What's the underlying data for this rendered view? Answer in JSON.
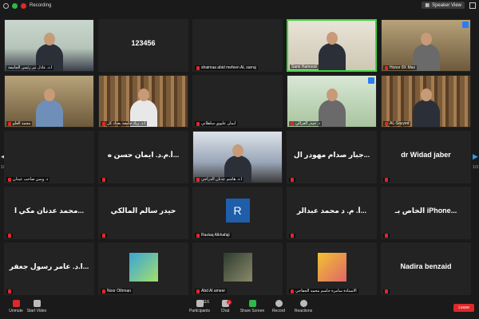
{
  "topbar": {
    "recording_label": "Recording",
    "speaker_view_label": "Speaker View"
  },
  "tiles": [
    {
      "name": "أ.د. عادل تبر رئيس الجامعة",
      "type": "video",
      "bg": "v-office",
      "person": "dark",
      "muted": false
    },
    {
      "name": "",
      "bigtext": "123456",
      "type": "text",
      "muted": false
    },
    {
      "name": "shaimaa abid mefeen AL sarraj",
      "type": "blank",
      "muted": true
    },
    {
      "name": "Sami Hamood",
      "type": "video",
      "bg": "v-light",
      "person": "dark",
      "muted": false,
      "active": true
    },
    {
      "name": "Honor 8X Max",
      "type": "video",
      "bg": "v-room",
      "person": "gray",
      "muted": true,
      "hand": true
    },
    {
      "name": "محمد العلو",
      "type": "video",
      "bg": "v-room",
      "person": "blue",
      "muted": true
    },
    {
      "name": "أ.د. زياد جامعة بغداد كل",
      "type": "video",
      "bg": "v-shelf",
      "person": "light",
      "muted": true
    },
    {
      "name": "ايمان عليوي سلطاني",
      "type": "blank",
      "muted": true
    },
    {
      "name": "د. حيدر الغزالي",
      "type": "video",
      "bg": "v-green",
      "person": "gray",
      "muted": true,
      "hand": true
    },
    {
      "name": "AL-Sayyed",
      "type": "video",
      "bg": "v-shelf",
      "person": "dark",
      "muted": true
    },
    {
      "name": "د. وسن صاحب عيدان",
      "bigtext": "",
      "type": "blank",
      "muted": true
    },
    {
      "name": "",
      "bigtext": "أ.م.د. ايمان حسن ه...",
      "type": "text",
      "muted": true
    },
    {
      "name": "ا.د. هاشم عدنان الدراجي",
      "type": "video",
      "bg": "v-podium",
      "person": "dark",
      "muted": true
    },
    {
      "name": "",
      "bigtext": "جبار صدام مهودر ال...",
      "type": "text",
      "muted": true
    },
    {
      "name": "",
      "bigtext": "dr Widad jaber",
      "type": "text",
      "muted": true
    },
    {
      "name": "",
      "bigtext": "محمد عدنان مكي ا...",
      "type": "text",
      "muted": true
    },
    {
      "name": "",
      "bigtext": "حيدر سالم المالكي",
      "type": "text",
      "muted": true
    },
    {
      "name": "Raziaq Alkhafaji",
      "type": "avatar",
      "letter": "R",
      "muted": true
    },
    {
      "name": "",
      "bigtext": "أ. م. د محمد عبدالر...",
      "type": "text",
      "muted": true
    },
    {
      "name": "",
      "bigtext": "الخاص بـ iPhone...",
      "type": "text",
      "muted": true
    },
    {
      "name": "",
      "bigtext": "ا.د. عامر رسول جعفر...",
      "type": "text",
      "muted": true
    },
    {
      "name": "Noor Othman",
      "type": "thumb",
      "thumb": "thumb-english",
      "muted": true
    },
    {
      "name": "Abd Al ameer",
      "type": "thumb",
      "thumb": "thumb-group",
      "muted": true
    },
    {
      "name": "الاستاذة سامرة جاسم محمد الخفاجي",
      "type": "thumb",
      "thumb": "thumb-girl",
      "muted": true
    },
    {
      "name": "",
      "bigtext": "Nadira benzaid",
      "type": "text",
      "muted": true
    }
  ],
  "page_indicator": "1/3",
  "toolbar": {
    "unmute": "Unmute",
    "start_video": "Start Video",
    "participants": "Participants",
    "participants_count": "116",
    "chat": "Chat",
    "chat_badge": "2",
    "share_screen": "Share Screen",
    "record": "Record",
    "reactions": "Reactions",
    "leave": "Leave"
  },
  "colors": {
    "active_speaker": "#3cd43c",
    "leave": "#e02828",
    "share": "#2db84d",
    "avatar": "#1f5eaa"
  }
}
